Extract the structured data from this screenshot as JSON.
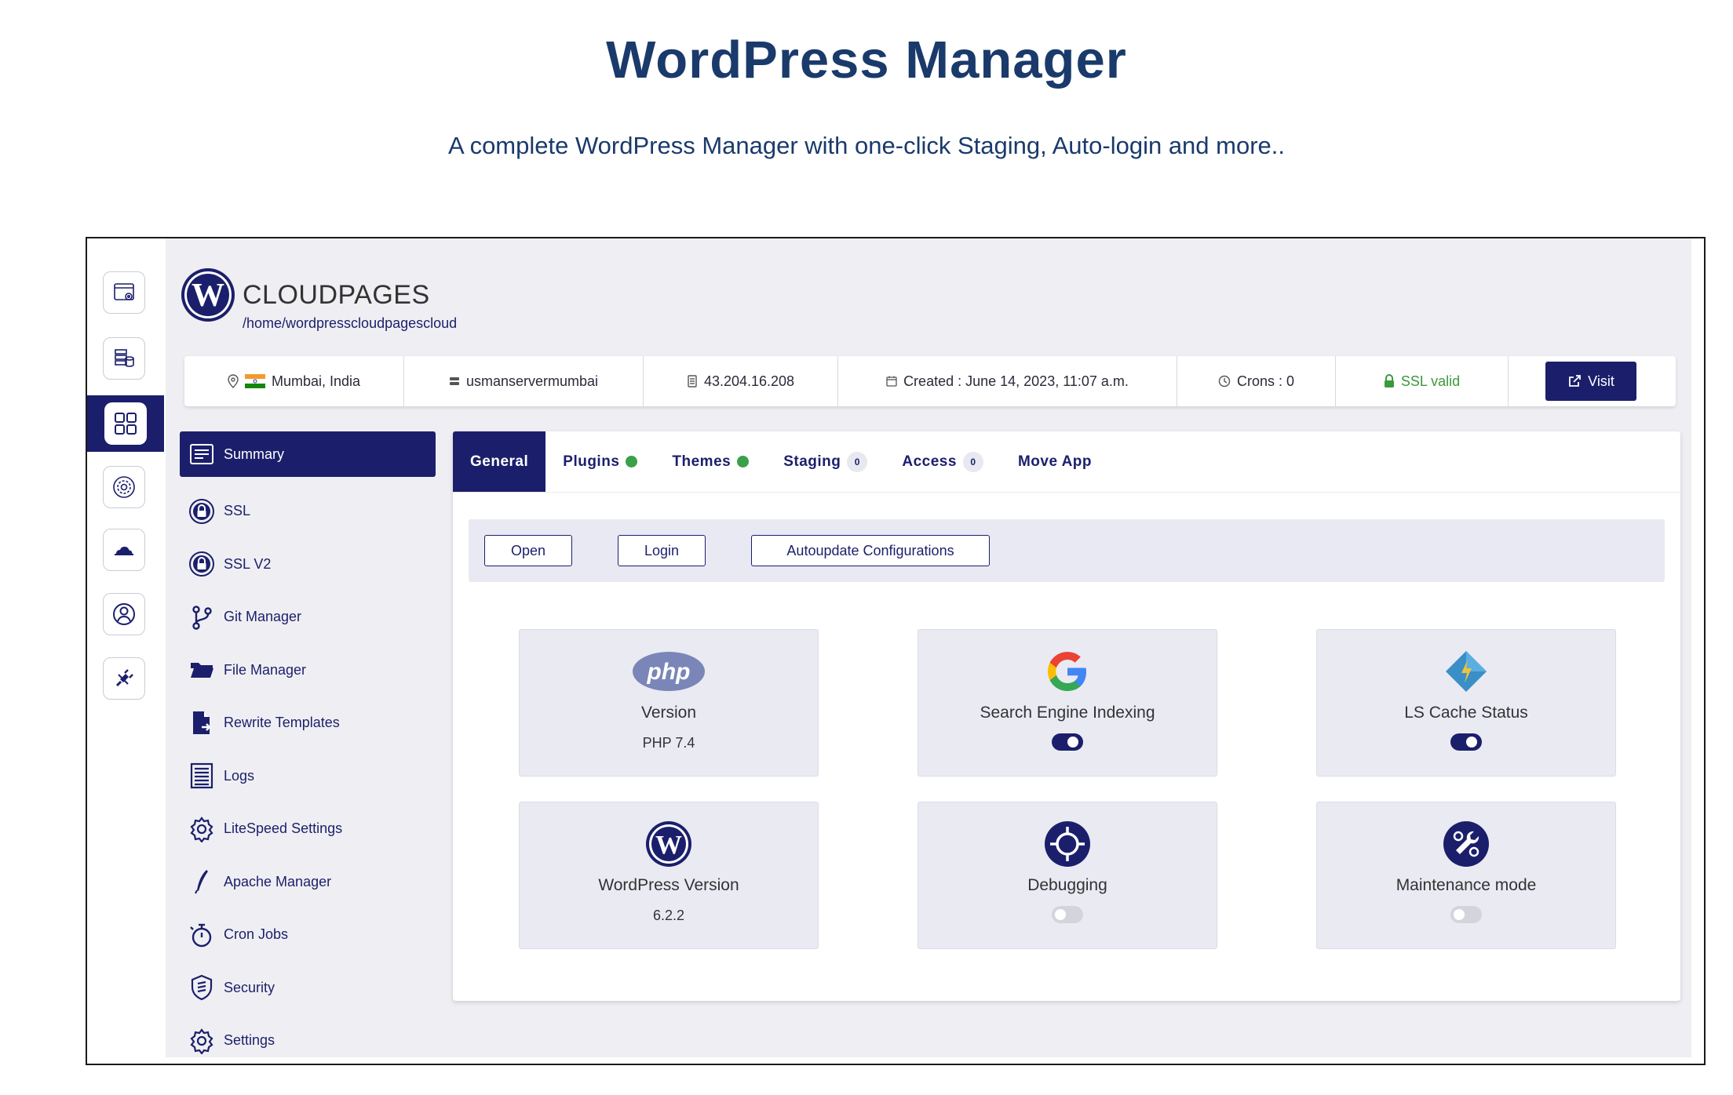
{
  "hero": {
    "title": "WordPress Manager",
    "subtitle": "A complete WordPress Manager with one-click Staging, Auto-login and more.."
  },
  "rail": {
    "items": [
      {
        "icon": "browser-settings-icon",
        "active": false
      },
      {
        "icon": "server-database-icon",
        "active": false
      },
      {
        "icon": "grid-apps-icon",
        "active": true
      },
      {
        "icon": "cog-circle-icon",
        "active": false
      },
      {
        "icon": "cloud-icon",
        "active": false
      },
      {
        "icon": "user-circle-icon",
        "active": false
      },
      {
        "icon": "plug-icon",
        "active": false
      }
    ]
  },
  "brand": {
    "name": "CLOUDPAGES",
    "path": "/home/wordpresscloudpagescloud"
  },
  "info": {
    "location": "Mumbai, India",
    "server": "usmanservermumbai",
    "ip": "43.204.16.208",
    "created": "Created : June 14, 2023, 11:07 a.m.",
    "crons": "Crons : 0",
    "ssl": "SSL valid",
    "visit": "Visit"
  },
  "menu": {
    "items": [
      {
        "label": "Summary",
        "icon": "summary-icon"
      },
      {
        "label": "SSL",
        "icon": "lock-icon"
      },
      {
        "label": "SSL V2",
        "icon": "lock-icon"
      },
      {
        "label": "Git Manager",
        "icon": "git-branch-icon"
      },
      {
        "label": "File Manager",
        "icon": "folder-icon"
      },
      {
        "label": "Rewrite Templates",
        "icon": "file-arrow-icon"
      },
      {
        "label": "Logs",
        "icon": "logs-icon"
      },
      {
        "label": "LiteSpeed Settings",
        "icon": "gear-icon"
      },
      {
        "label": "Apache Manager",
        "icon": "feather-icon"
      },
      {
        "label": "Cron Jobs",
        "icon": "stopwatch-icon"
      },
      {
        "label": "Security",
        "icon": "shield-icon"
      },
      {
        "label": "Settings",
        "icon": "gear-icon"
      }
    ]
  },
  "tabs": {
    "general": "General",
    "plugins": "Plugins",
    "themes": "Themes",
    "staging": "Staging",
    "staging_count": "0",
    "access": "Access",
    "access_count": "0",
    "move_app": "Move App"
  },
  "actions": {
    "open": "Open",
    "login": "Login",
    "autoupdate": "Autoupdate Configurations"
  },
  "tiles": {
    "php": {
      "logo": "php",
      "title": "Version",
      "value": "PHP 7.4"
    },
    "seo": {
      "title": "Search Engine Indexing",
      "toggle": "on"
    },
    "lscache": {
      "title": "LS Cache Status",
      "toggle": "on"
    },
    "wp": {
      "title": "WordPress Version",
      "value": "6.2.2"
    },
    "debug": {
      "title": "Debugging",
      "toggle": "off"
    },
    "maint": {
      "title": "Maintenance mode",
      "toggle": "off"
    }
  },
  "colors": {
    "navy": "#1b1f6b",
    "green": "#3aa04a",
    "panel": "#efeff3"
  }
}
